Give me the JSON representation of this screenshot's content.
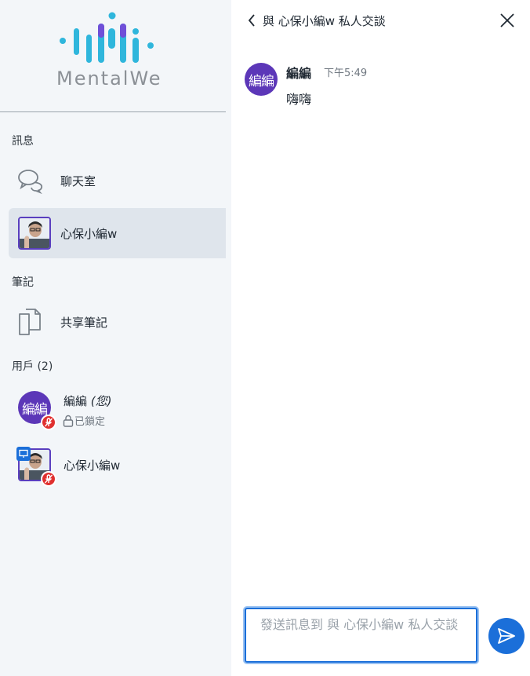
{
  "brand": {
    "logo_text": "MentalWe"
  },
  "sidebar": {
    "messages_section": "訊息",
    "chat_items": [
      {
        "label": "聊天室",
        "icon": "chat-bubbles-icon"
      },
      {
        "label": "心保小編w",
        "icon": "user-photo",
        "active": true
      }
    ],
    "notes_section": "筆記",
    "notes_items": [
      {
        "label": "共享筆記",
        "icon": "documents-icon"
      }
    ],
    "users_section": "用戶 (2)",
    "users": [
      {
        "name": "編編",
        "you_tag": "(您)",
        "avatar_text": "編編",
        "status": "已鎖定",
        "status_icon": "lock-icon",
        "mic": "muted"
      },
      {
        "name": "心保小編w",
        "avatar": "photo",
        "presenter": true,
        "mic": "muted"
      }
    ]
  },
  "chat": {
    "title": "與 心保小編w 私人交談",
    "messages": [
      {
        "sender": "編編",
        "avatar_text": "編編",
        "time": "下午5:49",
        "text": "嗨嗨"
      }
    ],
    "input_placeholder": "發送訊息到 與 心保小編w 私人交談"
  },
  "colors": {
    "accent": "#1b6fd9",
    "avatar_purple": "#5c37b8",
    "mic_red": "#e0302f",
    "sidebar_bg": "#f3f6f9",
    "active_bg": "#dfe5ec"
  }
}
